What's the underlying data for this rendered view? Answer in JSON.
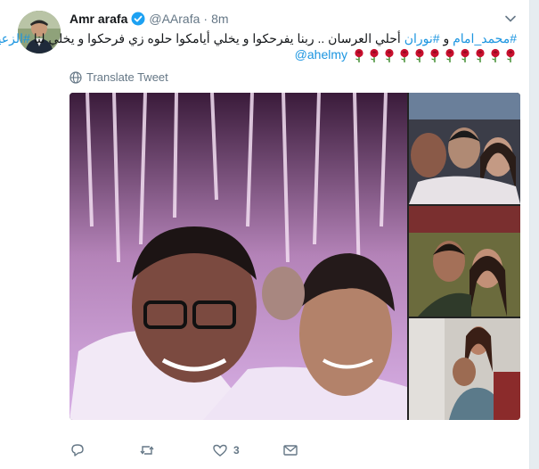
{
  "tweet": {
    "author_name": "Amr arafa",
    "author_handle": "@AArafa",
    "separator": "·",
    "time": "8m",
    "text_line1": "رمضان بالطب ‏#محمد_امام و #نوران أحلي العرسان .. ربنا يفرحكوا و يخلي أيامكوا حلوه زي فرحكوا و يخلي لنا #الزعيم",
    "text_line1_display": {
      "hashtag_imam": "#محمد_امام",
      "and1": " و ",
      "hashtag_nouran": "#نوران",
      "middle": " أحلي العرسان .. ربنا يفرحكوا و يخلي أيامكوا حلوه زي فرحكوا و يخلي لنا ",
      "hashtag_zaeem": "#الزعيم"
    },
    "mention": "@ahelmy",
    "rose_count": 11,
    "translate_label": "Translate Tweet",
    "reply_count": "",
    "retweet_count": "",
    "like_count": "3"
  },
  "colors": {
    "link": "#1b95e0",
    "text": "#14171a",
    "muted": "#657786",
    "verified": "#1da1f2"
  },
  "icons": {
    "verified": "verified-badge-icon",
    "chevron": "chevron-down-icon",
    "globe": "globe-icon",
    "reply": "reply-icon",
    "retweet": "retweet-icon",
    "like": "heart-icon",
    "dm": "envelope-icon",
    "rose": "rose-emoji-icon"
  }
}
